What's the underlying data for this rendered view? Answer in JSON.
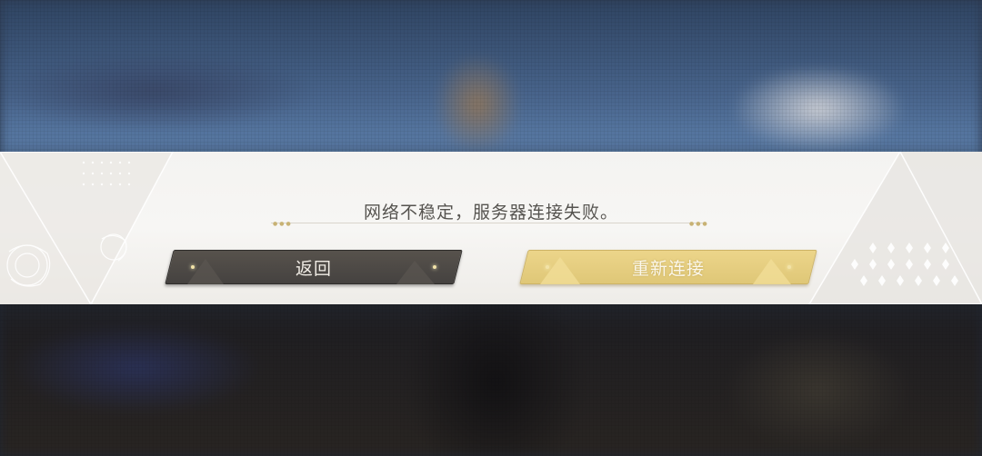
{
  "dialog": {
    "message": "网络不稳定，服务器连接失败。",
    "back_label": "返回",
    "reconnect_label": "重新连接"
  },
  "colors": {
    "back_button": "#4b4845",
    "reconnect_button": "#e6ce7f",
    "dialog_band": "#f5f4f2",
    "message_text": "#55534f"
  },
  "icons": {
    "left_decoration": "rose-outline-decoration",
    "right_decoration": "diamond-pattern-decoration"
  }
}
